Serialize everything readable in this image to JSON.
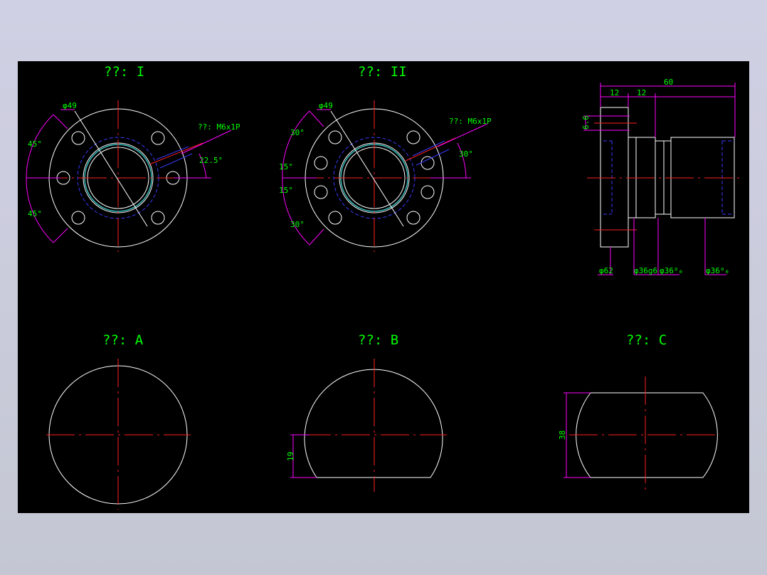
{
  "views": {
    "view1": {
      "title": "??: I",
      "dia": "φ49",
      "thread": "??: M6x1P",
      "angle1": "45°",
      "angle2": "45°",
      "angle3": "22.5°"
    },
    "view2": {
      "title": "??: II",
      "dia": "φ49",
      "thread": "??: M6x1P",
      "angle1": "30°",
      "angle2": "15°",
      "angle3": "15°",
      "angle4": "30°",
      "angle5": "30°"
    },
    "side": {
      "total": "60",
      "w1": "12",
      "w2": "12",
      "h1": "6.6",
      "d1": "φ62",
      "d2": "φ36g6",
      "d3": "φ36⁰₀",
      "d4": "φ36⁰₀"
    },
    "viewA": {
      "title": "??: A"
    },
    "viewB": {
      "title": "??: B",
      "dim": "19"
    },
    "viewC": {
      "title": "??: C",
      "dim": "38"
    }
  },
  "colors": {
    "background": "#000000",
    "outline": "#ffffff",
    "center": "#ff2020",
    "hidden": "#3a3aff",
    "dimension": "#ff00ff",
    "text": "#00ff00"
  }
}
